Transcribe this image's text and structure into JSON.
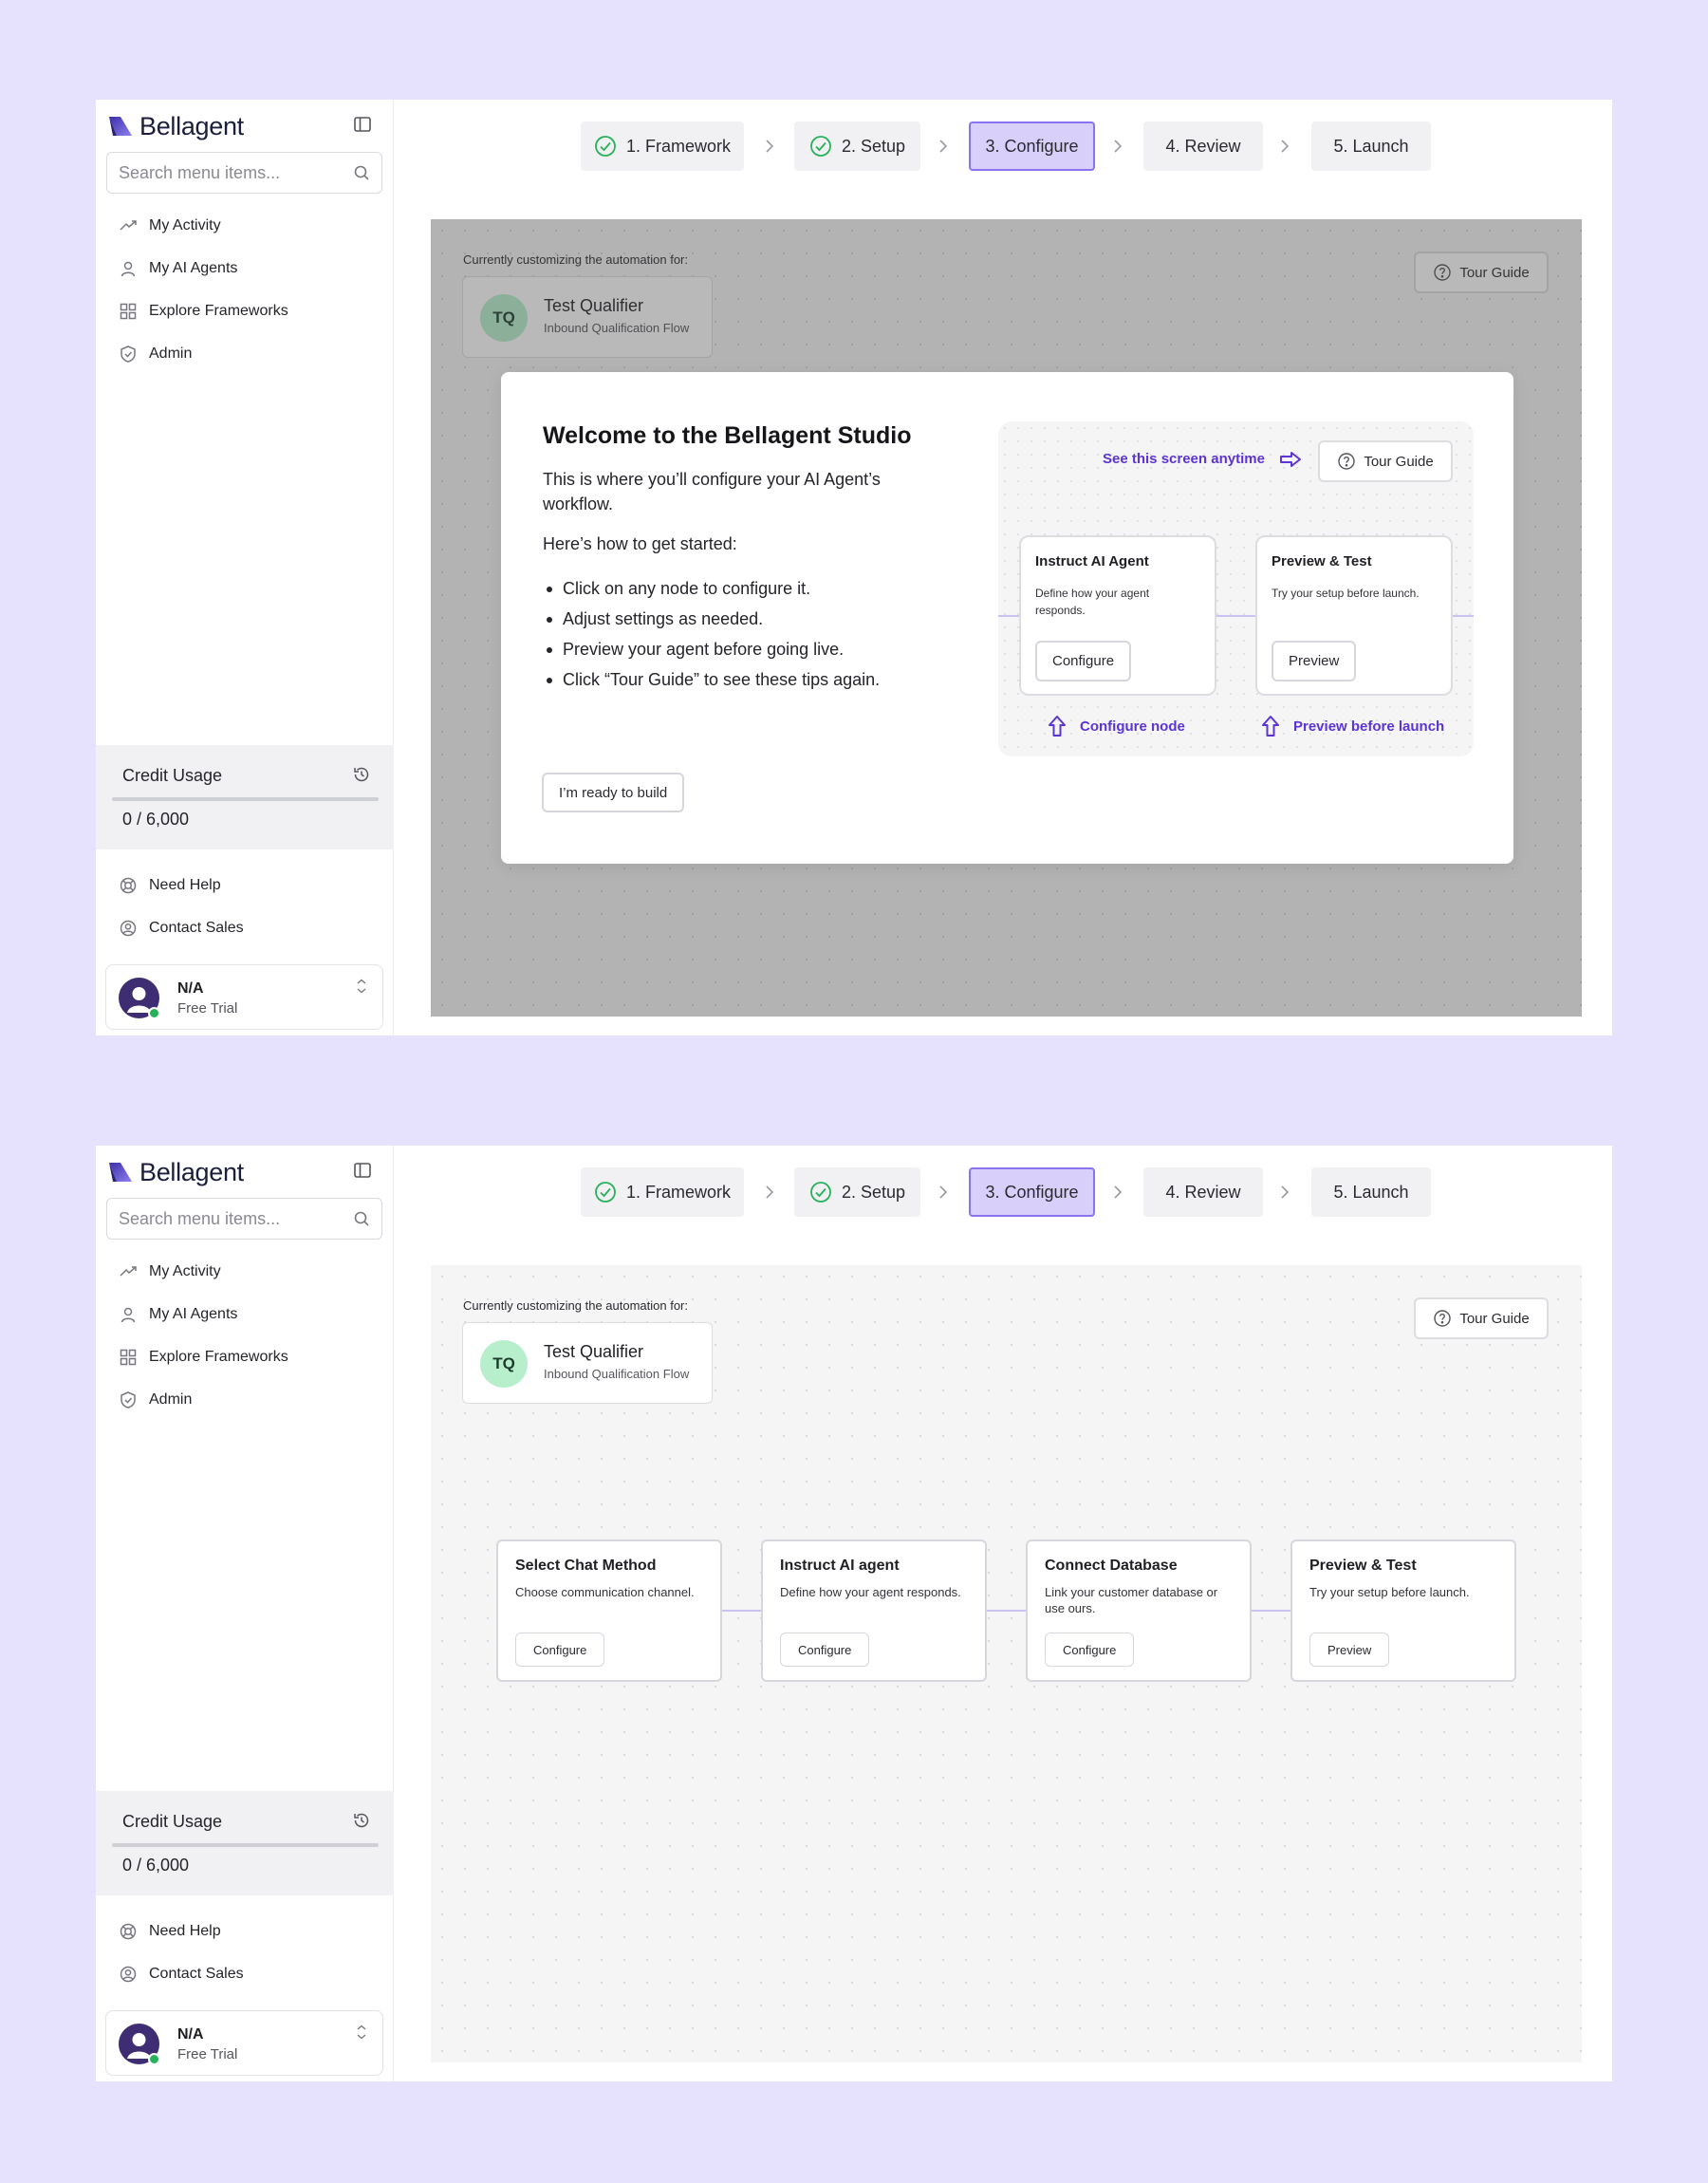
{
  "app": {
    "name": "Bellagent",
    "accent": "#6a4fd8",
    "brand_colors": [
      "#3c2fa8",
      "#8c7ff0"
    ]
  },
  "sidebar": {
    "search_placeholder": "Search menu items...",
    "items": [
      {
        "label": "My Activity",
        "icon": "trend-icon"
      },
      {
        "label": "My AI Agents",
        "icon": "user-icon"
      },
      {
        "label": "Explore Frameworks",
        "icon": "grid-icon"
      },
      {
        "label": "Admin",
        "icon": "shield-icon"
      }
    ],
    "credit": {
      "title": "Credit Usage",
      "used": 0,
      "total": 6000,
      "value_text": "0 / 6,000",
      "fraction": 0
    },
    "help_items": [
      {
        "label": "Need Help",
        "icon": "lifebuoy-icon"
      },
      {
        "label": "Contact Sales",
        "icon": "user-circle-icon"
      }
    ],
    "user": {
      "name": "N/A",
      "plan": "Free Trial",
      "status_color": "#27b25a"
    }
  },
  "stepper": {
    "steps": [
      {
        "label": "1. Framework",
        "state": "done"
      },
      {
        "label": "2. Setup",
        "state": "done"
      },
      {
        "label": "3. Configure",
        "state": "active"
      },
      {
        "label": "4. Review",
        "state": "pending"
      },
      {
        "label": "5. Launch",
        "state": "pending"
      }
    ]
  },
  "canvas": {
    "customizing_label": "Currently customizing the automation for:",
    "agent": {
      "initials": "TQ",
      "name": "Test Qualifier",
      "flow": "Inbound Qualification Flow"
    },
    "tour_guide_label": "Tour Guide",
    "nodes": [
      {
        "title": "Select Chat Method",
        "desc": "Choose communication channel.",
        "button": "Configure"
      },
      {
        "title": "Instruct AI agent",
        "desc": "Define how your agent responds.",
        "button": "Configure"
      },
      {
        "title": "Connect Database",
        "desc": "Link your customer database or use ours.",
        "button": "Configure"
      },
      {
        "title": "Preview & Test",
        "desc": "Try your setup before launch.",
        "button": "Preview"
      }
    ]
  },
  "modal": {
    "title": "Welcome to the Bellagent Studio",
    "intro": "This is where you’ll configure your AI Agent’s workflow.",
    "how_to": "Here’s how to get started:",
    "tips": [
      "Click on any node to configure it.",
      "Adjust settings as needed.",
      "Preview your agent before going live.",
      "Click “Tour Guide” to see these tips again."
    ],
    "ready_button": "I’m ready to build",
    "preview": {
      "hint": "See this screen anytime",
      "tour_button": "Tour Guide",
      "nodes": [
        {
          "title": "Instruct AI Agent",
          "desc": "Define how your agent responds.",
          "button": "Configure",
          "caption": "Configure node"
        },
        {
          "title": "Preview & Test",
          "desc": "Try your setup before launch.",
          "button": "Preview",
          "caption": "Preview before launch"
        }
      ]
    }
  }
}
